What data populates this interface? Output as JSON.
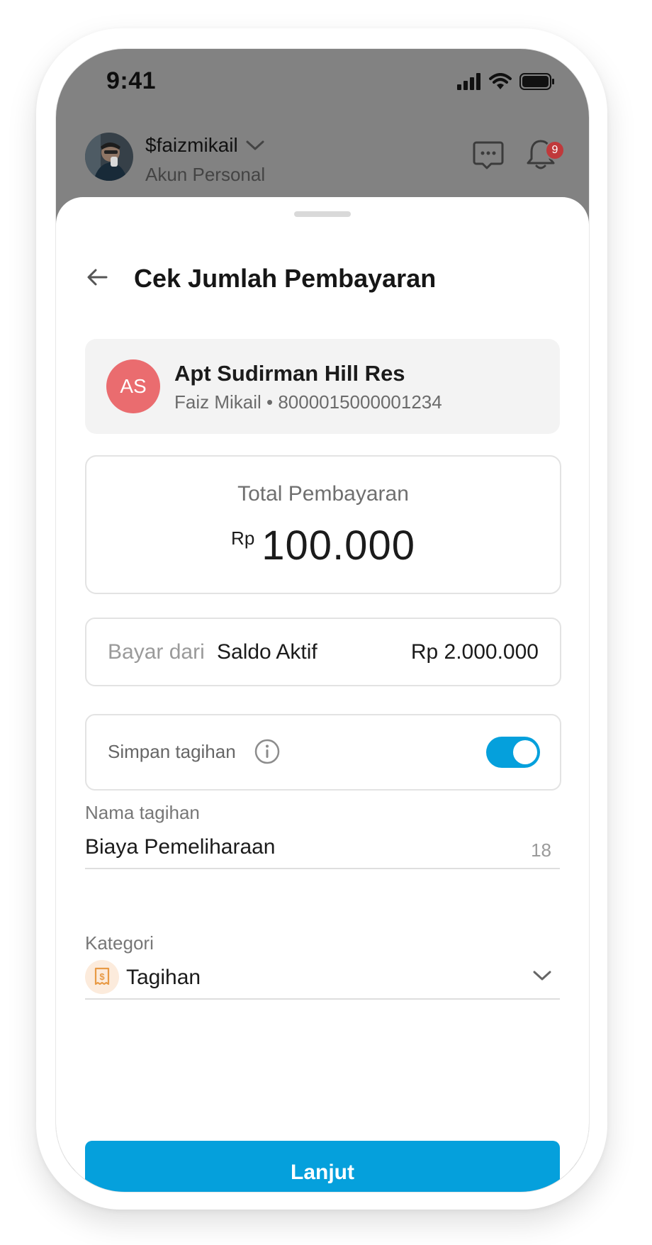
{
  "status_bar": {
    "time": "9:41"
  },
  "header": {
    "username": "$faizmikail",
    "account_type": "Akun Personal",
    "notification_count": "9"
  },
  "page": {
    "title": "Cek Jumlah Pembayaran"
  },
  "biller": {
    "initials": "AS",
    "name": "Apt Sudirman Hill Res",
    "detail": "Faiz Mikail • 8000015000001234",
    "avatar_color": "#ea6c6f"
  },
  "total": {
    "label": "Total Pembayaran",
    "currency": "Rp",
    "amount": "100.000"
  },
  "payment_source": {
    "label": "Bayar dari",
    "name": "Saldo Aktif",
    "balance": "Rp 2.000.000"
  },
  "save_bill": {
    "label": "Simpan tagihan",
    "enabled": true
  },
  "bill_name": {
    "label": "Nama tagihan",
    "value": "Biaya Pemeliharaan",
    "char_count": "18"
  },
  "category": {
    "label": "Kategori",
    "value": "Tagihan",
    "icon": "bill-icon"
  },
  "actions": {
    "continue_label": "Lanjut"
  },
  "colors": {
    "accent": "#05a0dc",
    "badge": "#c0393b",
    "category_icon_bg": "#fcebdc",
    "category_icon": "#e89a45"
  },
  "icons": [
    "cellular-signal-icon",
    "wifi-icon",
    "battery-icon",
    "chevron-down-icon",
    "chat-icon",
    "bell-icon",
    "back-arrow-icon",
    "info-icon",
    "bill-icon"
  ]
}
